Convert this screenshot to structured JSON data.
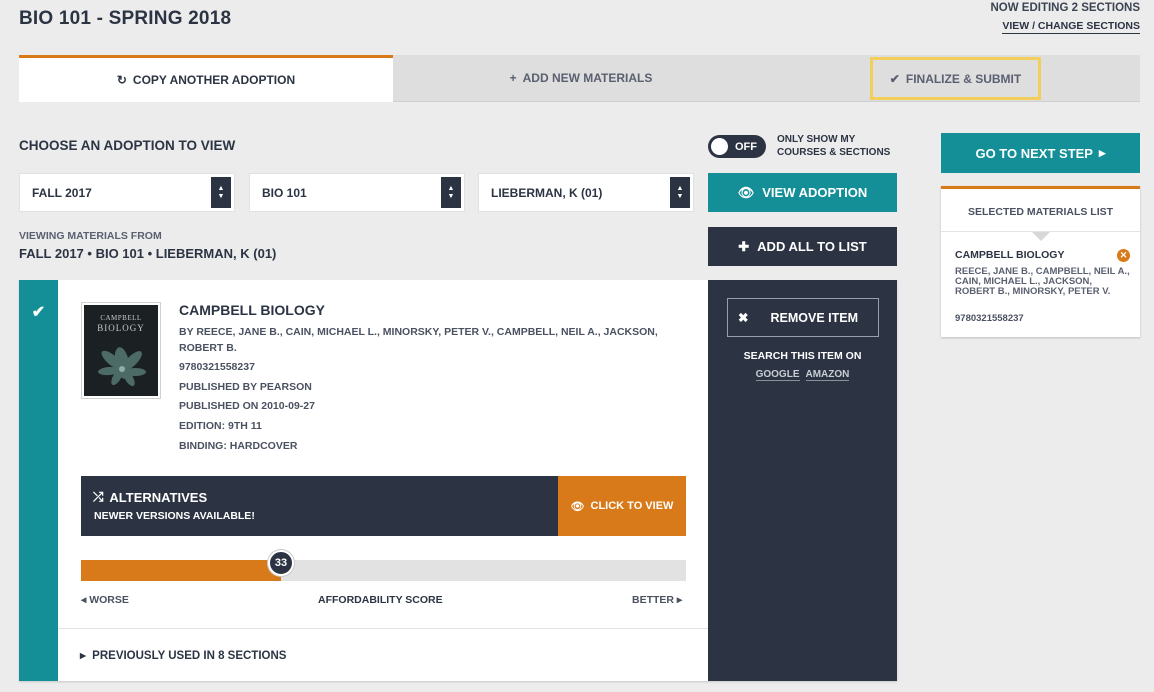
{
  "header": {
    "title": "BIO 101 - SPRING 2018",
    "editing_note": "NOW EDITING 2 SECTIONS",
    "change_link": "VIEW / CHANGE SECTIONS"
  },
  "tabs": [
    {
      "label": "COPY ANOTHER ADOPTION",
      "icon": "refresh-icon",
      "active": true
    },
    {
      "label": "ADD NEW MATERIALS",
      "icon": "plus-icon",
      "active": false
    },
    {
      "label": "FINALIZE & SUBMIT",
      "icon": "check-icon",
      "active": false,
      "highlighted": true
    }
  ],
  "chooser": {
    "title": "CHOOSE AN ADOPTION TO VIEW",
    "toggle_state": "OFF",
    "toggle_label": "ONLY SHOW MY COURSES & SECTIONS",
    "term_select": "FALL 2017",
    "course_select": "BIO 101",
    "instructor_select": "LIEBERMAN, K (01)",
    "view_button": "VIEW ADOPTION",
    "add_all_button": "ADD ALL TO LIST",
    "viewing_label": "VIEWING MATERIALS FROM",
    "viewing_value": "FALL 2017 • BIO 101 • LIEBERMAN, K (01)"
  },
  "item": {
    "cover_title": "CAMPBELL",
    "cover_subtitle": "BIOLOGY",
    "title": "CAMPBELL BIOLOGY",
    "authors": "BY REECE, JANE B., CAIN, MICHAEL L., MINORSKY, PETER V., CAMPBELL, NEIL A., JACKSON, ROBERT B.",
    "isbn": "9780321558237",
    "publisher": "PUBLISHED BY PEARSON",
    "published_on": "PUBLISHED ON 2010-09-27",
    "edition": "EDITION: 9TH 11",
    "binding": "BINDING: HARDCOVER",
    "alternatives_title": "ALTERNATIVES",
    "alternatives_sub": "NEWER VERSIONS AVAILABLE!",
    "alternatives_button": "CLICK TO VIEW",
    "score_value": "33",
    "score_fraction": 0.33,
    "score_worse": "WORSE",
    "score_label": "AFFORDABILITY SCORE",
    "score_better": "BETTER",
    "previously_used": "PREVIOUSLY USED IN 8 SECTIONS",
    "remove_button": "REMOVE ITEM",
    "search_label": "SEARCH THIS ITEM ON",
    "search_google": "GOOGLE",
    "search_amazon": "AMAZON"
  },
  "sidebar": {
    "next_button": "GO TO NEXT STEP",
    "list_header": "SELECTED MATERIALS LIST",
    "list_item_title": "CAMPBELL BIOLOGY",
    "list_item_authors": "REECE, JANE B., CAMPBELL, NEIL A., CAIN, MICHAEL L., JACKSON, ROBERT B., MINORSKY, PETER V.",
    "list_item_isbn": "9780321558237"
  },
  "colors": {
    "accent_teal": "#148f98",
    "accent_orange": "#d97a1a",
    "dark": "#2c3443",
    "highlight": "#f2cf5c"
  }
}
